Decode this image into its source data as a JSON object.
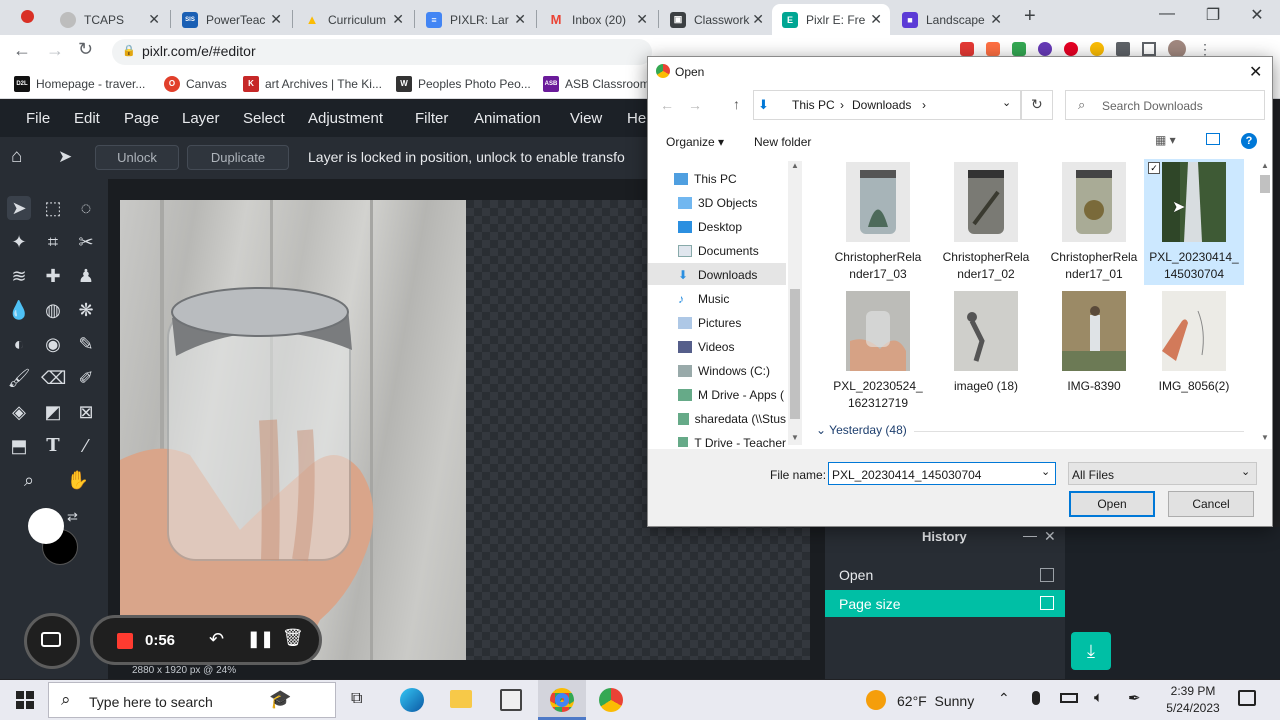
{
  "browser": {
    "tabs": [
      {
        "label": "TCAPS",
        "color": "#9e9e9e",
        "glyph": ""
      },
      {
        "label": "PowerTeac",
        "color": "#1a5fb4",
        "glyph": "SIS"
      },
      {
        "label": "Curriculum",
        "color": "#fbbc04",
        "glyph": "▲"
      },
      {
        "label": "PIXLR: Lar",
        "color": "#4285f4",
        "glyph": "≡"
      },
      {
        "label": "Inbox (20)",
        "color": "#ea4335",
        "glyph": "M"
      },
      {
        "label": "Classwork",
        "color": "#3c4043",
        "glyph": "▣"
      },
      {
        "label": "Pixlr E: Fre",
        "color": "#00a693",
        "glyph": "E"
      },
      {
        "label": "Landscape",
        "color": "#5c3bd6",
        "glyph": "■"
      }
    ],
    "url": "pixlr.com/e/#editor",
    "bookmarks": [
      {
        "label": "Homepage - traver...",
        "color": "#111",
        "glyph": "D2L"
      },
      {
        "label": "Canvas",
        "color": "#e13f2b",
        "glyph": "O"
      },
      {
        "label": "art Archives | The Ki...",
        "color": "#c62828",
        "glyph": "K"
      },
      {
        "label": "Peoples Photo Peo...",
        "color": "#333",
        "glyph": "W"
      },
      {
        "label": "ASB Classroom",
        "color": "#6a1b9a",
        "glyph": "ASB"
      }
    ]
  },
  "pixlr": {
    "menu": [
      "File",
      "Edit",
      "Page",
      "Layer",
      "Select",
      "Adjustment",
      "Filter",
      "Animation",
      "View",
      "He"
    ],
    "unlock_label": "Unlock",
    "duplicate_label": "Duplicate",
    "lock_message": "Layer is locked in position, unlock to enable transfo",
    "canvas_info": "2880 x 1920 px @ 24%",
    "recorder_time": "0:56",
    "history": {
      "title": "History",
      "items": [
        "Open",
        "Page size"
      ]
    }
  },
  "dialog": {
    "title": "Open",
    "breadcrumb": [
      "This PC",
      "Downloads"
    ],
    "search_placeholder": "Search Downloads",
    "organize_label": "Organize",
    "new_folder_label": "New folder",
    "nav": [
      "This PC",
      "3D Objects",
      "Desktop",
      "Documents",
      "Downloads",
      "Music",
      "Pictures",
      "Videos",
      "Windows (C:)",
      "M Drive - Apps (",
      "sharedata (\\\\Stus",
      "T Drive - Teacher"
    ],
    "files": [
      {
        "line1": "ChristopherRela",
        "line2": "nder17_03"
      },
      {
        "line1": "ChristopherRela",
        "line2": "nder17_02"
      },
      {
        "line1": "ChristopherRela",
        "line2": "nder17_01"
      },
      {
        "line1": "PXL_20230414_",
        "line2": "145030704"
      },
      {
        "line1": "PXL_20230524_",
        "line2": "162312719"
      },
      {
        "line1": "image0 (18)",
        "line2": ""
      },
      {
        "line1": "IMG-8390",
        "line2": ""
      },
      {
        "line1": "IMG_8056(2)",
        "line2": ""
      }
    ],
    "group_label": "Yesterday (48)",
    "filename_label": "File name:",
    "filename_value": "PXL_20230414_145030704",
    "filetype_value": "All Files",
    "open_button": "Open",
    "cancel_button": "Cancel"
  },
  "taskbar": {
    "search_placeholder": "Type here to search",
    "weather": "62°F  Sunny",
    "time": "2:39 PM",
    "date": "5/24/2023"
  },
  "colors": {
    "pixlr_accent": "#00bfa5",
    "dialog_accent": "#0078d7",
    "record_red": "#ff3b30"
  }
}
